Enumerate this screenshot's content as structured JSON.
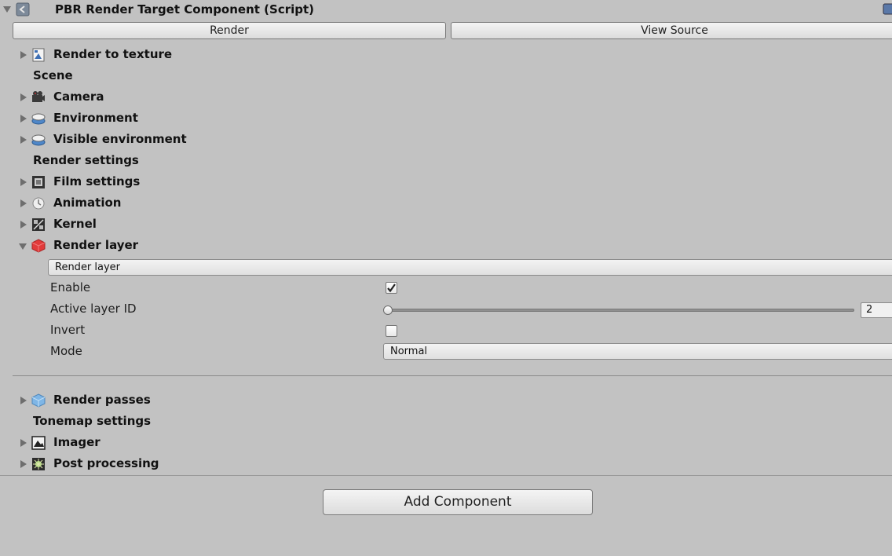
{
  "component": {
    "title": "PBR Render Target Component (Script)",
    "render_button": "Render",
    "view_source_button": "View Source"
  },
  "tree": {
    "render_to_texture": "Render to texture",
    "scene_header": "Scene",
    "camera": "Camera",
    "environment": "Environment",
    "visible_environment": "Visible environment",
    "render_settings_header": "Render settings",
    "film_settings": "Film settings",
    "animation": "Animation",
    "kernel": "Kernel",
    "render_layer": "Render layer",
    "render_passes": "Render passes",
    "tonemap_settings_header": "Tonemap settings",
    "imager": "Imager",
    "post_processing": "Post processing"
  },
  "render_layer_panel": {
    "dropdown_value": "Render layer",
    "enable_label": "Enable",
    "enable_checked": true,
    "active_layer_label": "Active layer ID",
    "active_layer_value": "2",
    "active_layer_slider_fraction": 0.0,
    "invert_label": "Invert",
    "invert_checked": false,
    "mode_label": "Mode",
    "mode_value": "Normal"
  },
  "footer": {
    "add_component_button": "Add Component"
  },
  "icons": {
    "component": "script-component-icon",
    "render_to_texture": "texture-icon",
    "camera": "camera-icon",
    "environment": "environment-icon",
    "visible_environment": "environment-icon",
    "film_settings": "film-icon",
    "animation": "clock-icon",
    "kernel": "kernel-icon",
    "render_layer": "red-cube-icon",
    "render_passes": "blue-cube-icon",
    "imager": "mountain-image-icon",
    "post_processing": "gear-burst-icon",
    "help": "help-book-icon"
  },
  "colors": {
    "background": "#c2c2c2",
    "render_layer_icon": "#e23b3b",
    "render_passes_icon": "#7fb6e6"
  }
}
